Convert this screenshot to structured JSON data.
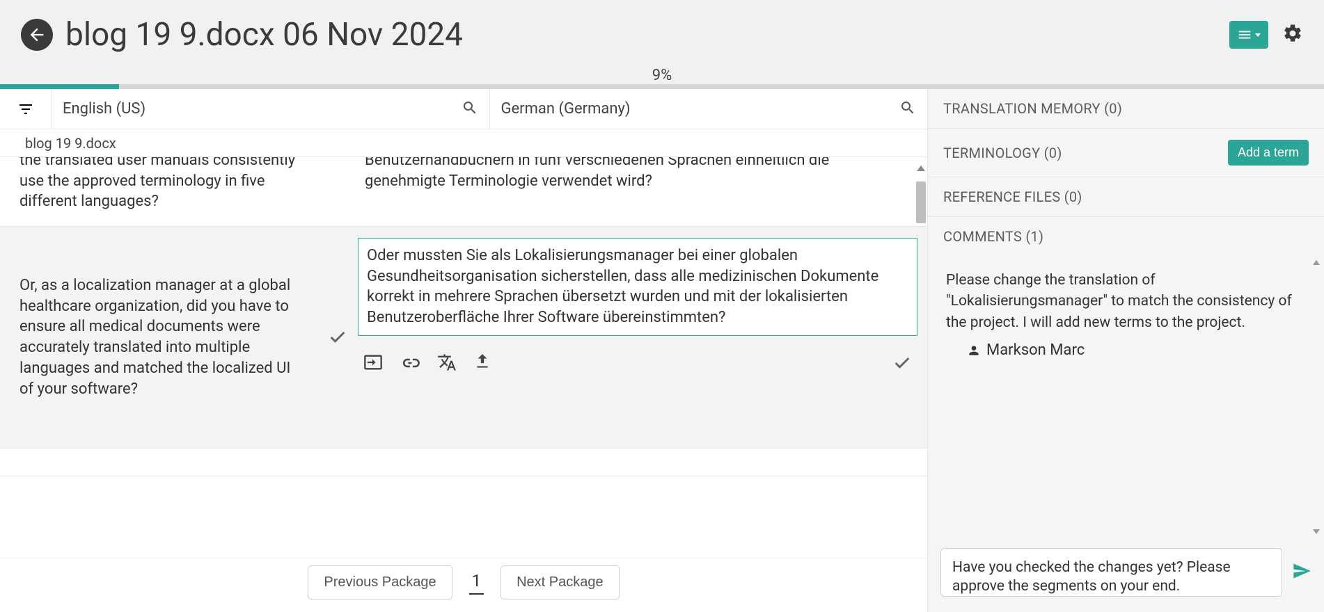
{
  "header": {
    "title": "blog 19 9.docx 06 Nov 2024"
  },
  "progress": {
    "percent_label": "9%",
    "percent_value": 9
  },
  "columns": {
    "source_lang": "English (US)",
    "target_lang": "German (Germany)"
  },
  "file_name": "blog 19 9.docx",
  "segments": [
    {
      "source": "the translated user manuals consistently use the approved terminology in five different languages?",
      "target": "Benutzerhandbüchern in fünf verschiedenen Sprachen einheitlich die genehmigte Terminologie verwendet wird?",
      "active": false
    },
    {
      "source": "Or, as a localization manager at a global healthcare organization, did you have to ensure all medical documents were accurately translated into multiple languages and matched the localized UI of your software?",
      "target": "Oder mussten Sie als Lokalisierungsmanager bei einer globalen Gesundheitsorganisation sicherstellen, dass alle medizinischen Dokumente korrekt in mehrere Sprachen übersetzt wurden und mit der lokalisierten Benutzeroberfläche Ihrer Software übereinstimmten?",
      "active": true
    }
  ],
  "pager": {
    "prev_label": "Previous Package",
    "next_label": "Next Package",
    "page": "1"
  },
  "side_panel": {
    "tm": {
      "title": "TRANSLATION MEMORY (0)"
    },
    "terminology": {
      "title": "TERMINOLOGY (0)",
      "add_term_label": "Add a term"
    },
    "reference": {
      "title": "REFERENCE FILES (0)"
    },
    "comments": {
      "title": "COMMENTS (1)",
      "item": {
        "text": "Please change the translation of \"Lokalisierungsmanager\" to match the consistency of the project. I will add new terms to the project.",
        "author": "Markson Marc"
      },
      "input_value": "Have you checked the changes yet? Please approve the segments on your end."
    }
  }
}
